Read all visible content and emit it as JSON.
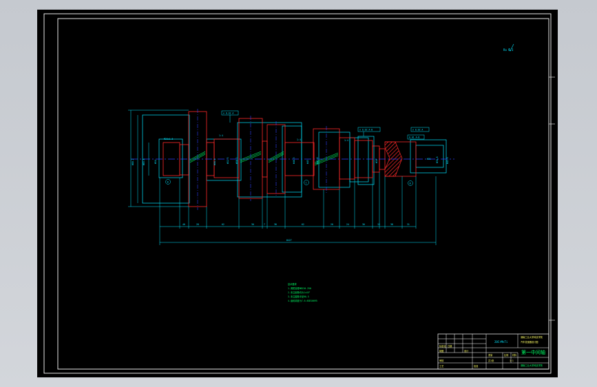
{
  "colors": {
    "canvas": "#000000",
    "frame": "#ffffff",
    "outline": "#ff2a2a",
    "section": "#00e5ff",
    "centerline": "#3040ff",
    "hatch": "#ff2a2a",
    "note": "#00ff66",
    "title_text": "#ffff66",
    "viewport_bg": "#c8ccd2"
  },
  "drawing": {
    "roughness_mark": "Ra 6.3",
    "thread_label": "M20x1.5",
    "helix_left": "1:4",
    "helix_mid": "1:4",
    "helix_right": "1:4",
    "datum_a": "B",
    "datum_b": "C",
    "datum_c": "B",
    "gdt_left": "⌀ 0.02 A",
    "gdt_mid": "⌀ 0.02 A-B",
    "gdt_right": "⌀ 0.02 A",
    "gdt_right2": "0.01 A-B",
    "diameters": [
      "Φ80.2",
      "Φ65.8",
      "Φ54",
      "Φ68.0",
      "Φ52.5",
      "Φ58.2",
      "Φ48.5",
      "Φ45",
      "Φ42.6",
      "Φ30",
      "Φ38.8",
      "Φ31",
      "Φ45.9"
    ],
    "dimensions": [
      "40",
      "28",
      "62",
      "30",
      "7",
      "38",
      "62",
      "20",
      "24",
      "30",
      "15",
      "38",
      "31"
    ],
    "total_length": "Φ427",
    "notes": {
      "title": "技术要求",
      "items": [
        "1.调质处理HB220-250",
        "2.未注倒角均为1×45°",
        "3.未注圆角半径R0.5",
        "4.齿轮精度为7-6-6GB10095"
      ]
    }
  },
  "title_block": {
    "school": "湖南工业大学科技学院",
    "subtitle": "汽车变速器设计图",
    "drawing_no": "20CrMnTi",
    "part_name": "第一中间轴",
    "designer": "设计",
    "checker": "审核",
    "scale": "比例",
    "scale_value": "1:1",
    "sheet": "共1张",
    "weight": "重量",
    "material": "材料",
    "standard": "标准化",
    "date": "日期",
    "approve": "批准",
    "process": "工艺",
    "drawn": "制图",
    "footer": "湖南工业大学科技学院"
  }
}
